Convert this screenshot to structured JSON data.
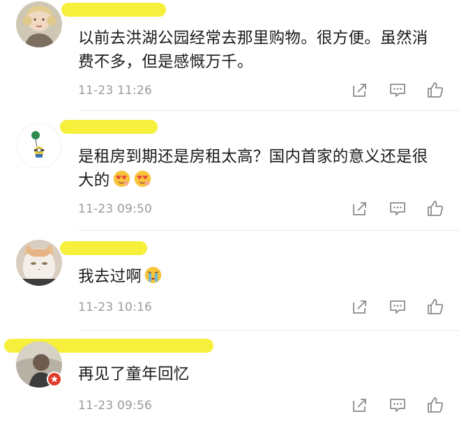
{
  "comments": [
    {
      "text": "以前去洪湖公园经常去那里购物。很方便。虽然消费不多，但是感慨万千。",
      "time": "11-23 11:26",
      "avatar": "woman-portrait-avatar"
    },
    {
      "text": "是租房到期还是房租太高？国内首家的意义还是很大的",
      "time": "11-23 09:50",
      "avatar": "minion-balloon-avatar",
      "emojis": [
        "heart-eyes-face-emoji",
        "heart-eyes-face-emoji"
      ]
    },
    {
      "text": "我去过啊",
      "time": "11-23 10:16",
      "avatar": "cat-avatar",
      "emojis": [
        "crying-face-emoji"
      ]
    },
    {
      "text": "再见了童年回忆",
      "time": "11-23 09:56",
      "avatar": "person-avatar",
      "badge": "verified-badge-icon"
    }
  ],
  "actions": {
    "share_icon": "share-icon",
    "reply_icon": "comment-icon",
    "like_icon": "thumbs-up-icon"
  },
  "colors": {
    "highlight": "#f5ef2c",
    "timestamp": "#9a9a9a",
    "text": "#1a1a1a",
    "icon": "#8a8a8a",
    "badge": "#e03b2a"
  }
}
